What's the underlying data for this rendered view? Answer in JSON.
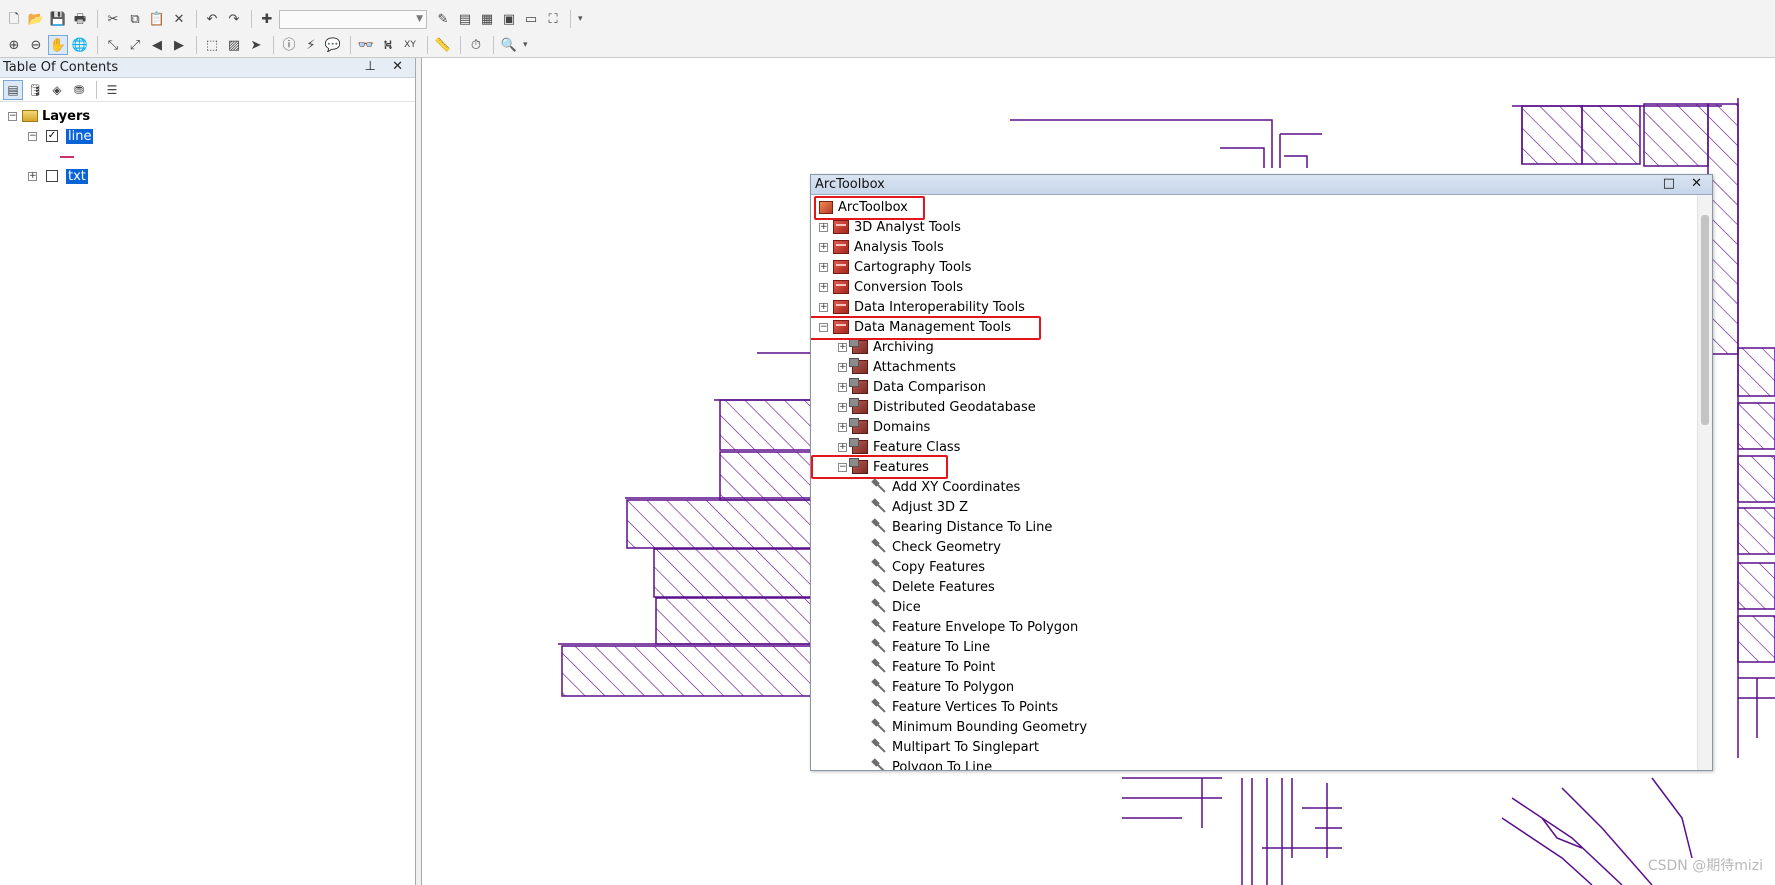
{
  "toolbar": {
    "row1_icons": [
      "new-doc-icon",
      "open-folder-icon",
      "save-icon",
      "print-icon",
      "cut-icon",
      "copy-icon",
      "paste-icon",
      "delete-icon",
      "undo-icon",
      "redo-icon",
      "add-data-icon",
      "editor-icon",
      "table-icon",
      "catalog-icon",
      "arctoolbox-icon",
      "python-icon",
      "model-icon"
    ],
    "row1_glyphs": [
      "🗋",
      "📂",
      "💾",
      "🖶",
      "✂",
      "⧉",
      "📋",
      "✕",
      "↶",
      "↷",
      "✚",
      "✎",
      "▤",
      "▦",
      "▣",
      "▭",
      "⛶"
    ],
    "row2_icons": [
      "zoom-in-icon",
      "zoom-out-icon",
      "pan-icon",
      "full-extent-icon",
      "fixed-zoom-in-icon",
      "fixed-zoom-out-icon",
      "back-icon",
      "forward-icon",
      "select-features-icon",
      "clear-selection-icon",
      "select-elements-icon",
      "identify-icon",
      "hyperlink-icon",
      "html-popup-icon",
      "find-icon",
      "find-route-icon",
      "go-to-xy-icon",
      "measure-icon",
      "time-slider-icon",
      "viewer-icon"
    ],
    "row2_glyphs": [
      "⊕",
      "⊖",
      "✋",
      "🌐",
      "⤡",
      "⤢",
      "◀",
      "▶",
      "⬚",
      "▨",
      "➤",
      "ⓘ",
      "⚡",
      "💬",
      "👓",
      "⛕",
      "XY",
      "📏",
      "⏱",
      "🔍"
    ],
    "scale_value": ""
  },
  "toc": {
    "title": "Table Of Contents",
    "title_controls": "⊥ ✕",
    "layers_label": "Layers",
    "layers": [
      {
        "name": "line",
        "checked": true,
        "expanded": true
      },
      {
        "name": "txt",
        "checked": false,
        "expanded": false
      }
    ]
  },
  "arctoolbox": {
    "title": "ArcToolbox",
    "controls": "□ ✕",
    "root": "ArcToolbox",
    "toolboxes": [
      "3D Analyst Tools",
      "Analysis Tools",
      "Cartography Tools",
      "Conversion Tools",
      "Data Interoperability Tools",
      "Data Management Tools"
    ],
    "toolsets": [
      "Archiving",
      "Attachments",
      "Data Comparison",
      "Distributed Geodatabase",
      "Domains",
      "Feature Class",
      "Features"
    ],
    "tools": [
      "Add XY Coordinates",
      "Adjust 3D Z",
      "Bearing Distance To Line",
      "Check Geometry",
      "Copy Features",
      "Delete Features",
      "Dice",
      "Feature Envelope To Polygon",
      "Feature To Line",
      "Feature To Point",
      "Feature To Polygon",
      "Feature Vertices To Points",
      "Minimum Bounding Geometry",
      "Multipart To Singlepart",
      "Polygon To Line"
    ]
  },
  "watermark": "CSDN @期待mizi",
  "colors": {
    "map_line": "#5a0e8c",
    "highlight": "#e3161b",
    "selection": "#0a64d6"
  }
}
